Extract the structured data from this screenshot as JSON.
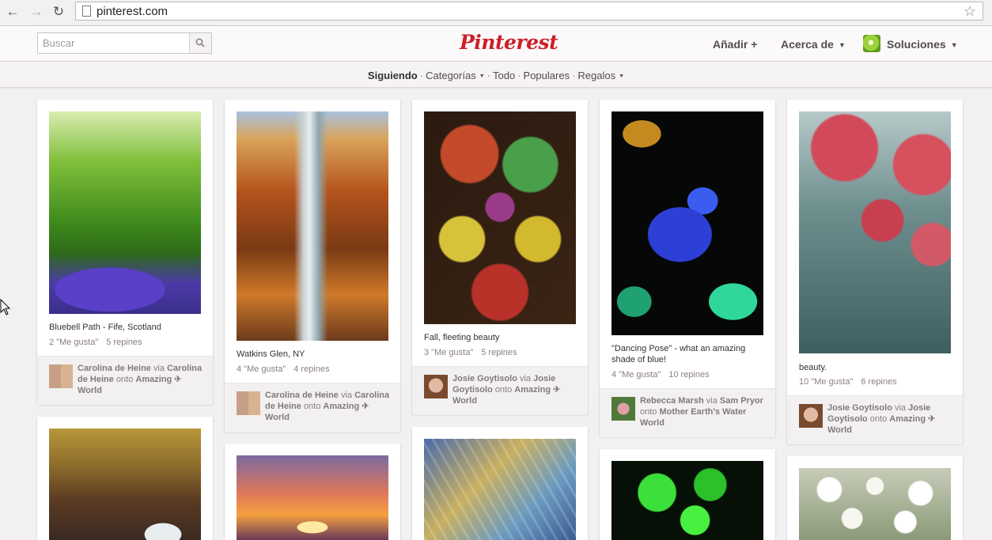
{
  "browser": {
    "url": "pinterest.com"
  },
  "header": {
    "search_placeholder": "Buscar",
    "logo": "Pinterest",
    "add_label": "Añadir +",
    "about_label": "Acerca de",
    "user_label": "Soluciones"
  },
  "subnav": {
    "following": "Siguiendo",
    "categories": "Categorías",
    "all": "Todo",
    "popular": "Populares",
    "gifts": "Regalos"
  },
  "pins": [
    {
      "description": "Bluebell Path - Fife, Scotland",
      "likes": "2 \"Me gusta\"",
      "repins": "5 repines",
      "pinner": "Carolina de Heine",
      "via_word": "via",
      "via": "Carolina de Heine",
      "onto_word": "onto",
      "board": "Amazing ✈ World"
    },
    {
      "description": "Watkins Glen, NY",
      "likes": "4 \"Me gusta\"",
      "repins": "4 repines",
      "pinner": "Carolina de Heine",
      "via_word": "via",
      "via": "Carolina de Heine",
      "onto_word": "onto",
      "board": "Amazing ✈ World"
    },
    {
      "description": "Fall, fleeting beauty",
      "likes": "3 \"Me gusta\"",
      "repins": "5 repines",
      "pinner": "Josie Goytisolo",
      "via_word": "via",
      "via": "Josie Goytisolo",
      "onto_word": "onto",
      "board": "Amazing ✈ World"
    },
    {
      "description": "\"Dancing Pose\" - what an amazing shade of blue!",
      "likes": "4 \"Me gusta\"",
      "repins": "10 repines",
      "pinner": "Rebecca Marsh",
      "via_word": "via",
      "via": "Sam Pryor",
      "onto_word": "onto",
      "board": "Mother Earth's Water World"
    },
    {
      "description": "beauty.",
      "likes": "10 \"Me gusta\"",
      "repins": "6 repines",
      "pinner": "Josie Goytisolo",
      "via_word": "via",
      "via": "Josie Goytisolo",
      "onto_word": "onto",
      "board": "Amazing ✈ World"
    }
  ],
  "colors": {
    "brand_red": "#cb2027",
    "page_bg": "#f2f0f0",
    "text_muted": "#8c7e7e"
  }
}
